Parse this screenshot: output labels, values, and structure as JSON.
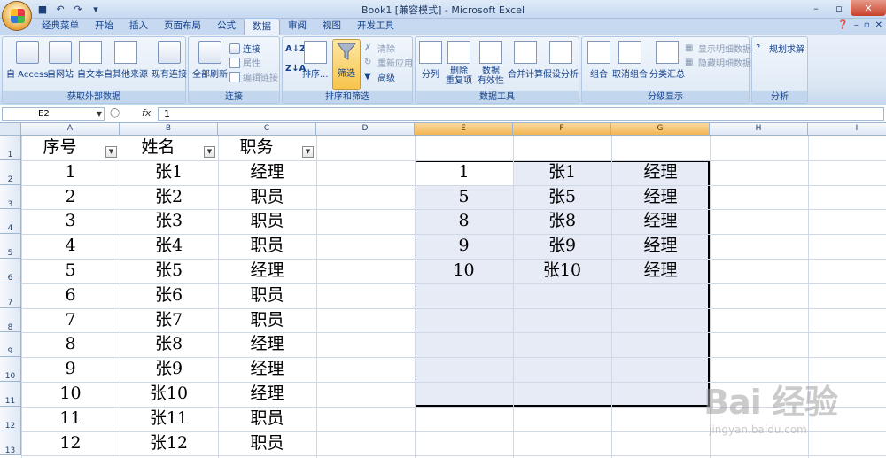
{
  "window": {
    "title": "Book1 [兼容模式] - Microsoft Excel",
    "controls": [
      "–",
      "▫",
      "✕"
    ]
  },
  "qat": {
    "icons": [
      "save-icon",
      "undo-icon",
      "redo-icon",
      "customize-icon"
    ]
  },
  "tabs": [
    "经典菜单",
    "开始",
    "插入",
    "页面布局",
    "公式",
    "数据",
    "审阅",
    "视图",
    "开发工具"
  ],
  "active_tab": "数据",
  "ribbon": {
    "groups": {
      "external": {
        "label": "获取外部数据",
        "buttons": [
          "自 Access",
          "自网站",
          "自文本",
          "自其他来源",
          "现有连接"
        ]
      },
      "connections": {
        "label": "连接",
        "refresh": "全部刷新",
        "small": [
          "连接",
          "属性",
          "编辑链接"
        ]
      },
      "sort_filter": {
        "label": "排序和筛选",
        "sort": "排序...",
        "filter": "筛选",
        "small": [
          "清除",
          "重新应用",
          "高级"
        ]
      },
      "data_tools": {
        "label": "数据工具",
        "buttons": [
          "分列",
          "删除\n重复项",
          "数据\n有效性",
          "合并计算",
          "假设分析"
        ]
      },
      "outline": {
        "label": "分级显示",
        "buttons": [
          "组合",
          "取消组合",
          "分类汇总"
        ],
        "small": [
          "显示明细数据",
          "隐藏明细数据"
        ]
      },
      "analysis": {
        "label": "分析",
        "solver": "规划求解"
      }
    }
  },
  "formula_bar": {
    "name_box": "E2",
    "fx": "fx",
    "value": "1"
  },
  "sheet": {
    "columns": [
      "A",
      "B",
      "C",
      "D",
      "E",
      "F",
      "G",
      "H",
      "I"
    ],
    "selected_columns": [
      "E",
      "F",
      "G"
    ],
    "row_numbers": [
      "1",
      "2",
      "3",
      "4",
      "5",
      "6",
      "7",
      "8",
      "9",
      "10",
      "11",
      "12",
      "13"
    ],
    "headers": [
      "序号",
      "姓名",
      "职务"
    ],
    "table": [
      [
        "1",
        "张1",
        "经理"
      ],
      [
        "2",
        "张2",
        "职员"
      ],
      [
        "3",
        "张3",
        "职员"
      ],
      [
        "4",
        "张4",
        "职员"
      ],
      [
        "5",
        "张5",
        "经理"
      ],
      [
        "6",
        "张6",
        "职员"
      ],
      [
        "7",
        "张7",
        "职员"
      ],
      [
        "8",
        "张8",
        "经理"
      ],
      [
        "9",
        "张9",
        "经理"
      ],
      [
        "10",
        "张10",
        "经理"
      ],
      [
        "11",
        "张11",
        "职员"
      ],
      [
        "12",
        "张12",
        "职员"
      ]
    ],
    "filtered": [
      [
        "1",
        "张1",
        "经理"
      ],
      [
        "5",
        "张5",
        "经理"
      ],
      [
        "8",
        "张8",
        "经理"
      ],
      [
        "9",
        "张9",
        "经理"
      ],
      [
        "10",
        "张10",
        "经理"
      ]
    ]
  },
  "watermark": {
    "big": "Bai 经验",
    "small": "jingyan.baidu.com"
  },
  "colors": {
    "ribbon": "#dbe6f4",
    "selection": "#c8d2eb",
    "selected_header": "#f3b552"
  }
}
